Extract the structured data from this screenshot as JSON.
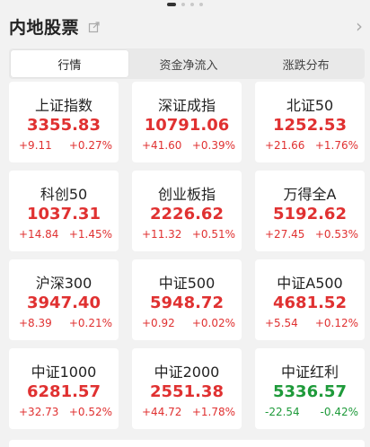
{
  "header": {
    "title": "内地股票",
    "chevron": "›"
  },
  "tabs": [
    {
      "label": "行情"
    },
    {
      "label": "资金净流入"
    },
    {
      "label": "涨跌分布"
    }
  ],
  "colors": {
    "up": "#e03131",
    "down": "#1e9a3a"
  },
  "indices": [
    {
      "name": "上证指数",
      "price": "3355.83",
      "change": "+9.11",
      "pct": "+0.27%",
      "trend": "up"
    },
    {
      "name": "深证成指",
      "price": "10791.06",
      "change": "+41.60",
      "pct": "+0.39%",
      "trend": "up"
    },
    {
      "name": "北证50",
      "price": "1252.53",
      "change": "+21.66",
      "pct": "+1.76%",
      "trend": "up"
    },
    {
      "name": "科创50",
      "price": "1037.31",
      "change": "+14.84",
      "pct": "+1.45%",
      "trend": "up"
    },
    {
      "name": "创业板指",
      "price": "2226.62",
      "change": "+11.32",
      "pct": "+0.51%",
      "trend": "up"
    },
    {
      "name": "万得全A",
      "price": "5192.62",
      "change": "+27.45",
      "pct": "+0.53%",
      "trend": "up"
    },
    {
      "name": "沪深300",
      "price": "3947.40",
      "change": "+8.39",
      "pct": "+0.21%",
      "trend": "up"
    },
    {
      "name": "中证500",
      "price": "5948.72",
      "change": "+0.92",
      "pct": "+0.02%",
      "trend": "up"
    },
    {
      "name": "中证A500",
      "price": "4681.52",
      "change": "+5.54",
      "pct": "+0.12%",
      "trend": "up"
    },
    {
      "name": "中证1000",
      "price": "6281.57",
      "change": "+32.73",
      "pct": "+0.52%",
      "trend": "up"
    },
    {
      "name": "中证2000",
      "price": "2551.38",
      "change": "+44.72",
      "pct": "+1.78%",
      "trend": "up"
    },
    {
      "name": "中证红利",
      "price": "5336.57",
      "change": "-22.54",
      "pct": "-0.42%",
      "trend": "down"
    }
  ]
}
